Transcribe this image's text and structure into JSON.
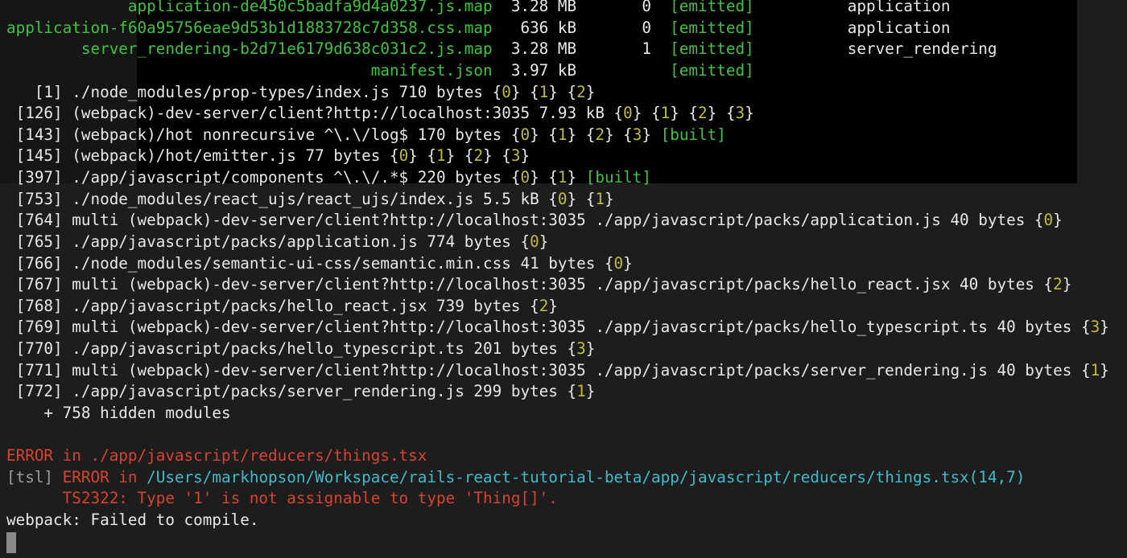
{
  "colors": {
    "white": "#e8e8e8",
    "green": "#3fc43f",
    "yellow": "#c2bc3a",
    "red": "#d8432f",
    "cyan": "#3fbccc",
    "gray": "#9c9c9c"
  },
  "terminal": {
    "lines": [
      {
        "segs": [
          [
            "g",
            "             application-de450c5badfa9d4a0237.js.map"
          ],
          [
            "w",
            "  3.28 MB       0  "
          ],
          [
            "g",
            "[emitted]"
          ],
          [
            "w",
            "          application"
          ]
        ]
      },
      {
        "segs": [
          [
            "g",
            "application-f60a95756eae9d53b1d1883728c7d358.css.map"
          ],
          [
            "w",
            "   636 kB       0  "
          ],
          [
            "g",
            "[emitted]"
          ],
          [
            "w",
            "          application"
          ]
        ]
      },
      {
        "segs": [
          [
            "g",
            "        server_rendering-b2d71e6179d638c031c2.js.map"
          ],
          [
            "w",
            "  3.28 MB       1  "
          ],
          [
            "g",
            "[emitted]"
          ],
          [
            "w",
            "          server_rendering"
          ]
        ]
      },
      {
        "segs": [
          [
            "g",
            "                                       manifest.json"
          ],
          [
            "w",
            "  3.97 kB          "
          ],
          [
            "g",
            "[emitted]"
          ]
        ]
      },
      {
        "segs": [
          [
            "w",
            "   [1] ./node_modules/prop-types/index.js 710 bytes {"
          ],
          [
            "y",
            "0"
          ],
          [
            "w",
            "} {"
          ],
          [
            "y",
            "1"
          ],
          [
            "w",
            "} {"
          ],
          [
            "y",
            "2"
          ],
          [
            "w",
            "}"
          ]
        ]
      },
      {
        "segs": [
          [
            "w",
            " [126] (webpack)-dev-server/client?http://localhost:3035 7.93 kB {"
          ],
          [
            "y",
            "0"
          ],
          [
            "w",
            "} {"
          ],
          [
            "y",
            "1"
          ],
          [
            "w",
            "} {"
          ],
          [
            "y",
            "2"
          ],
          [
            "w",
            "} {"
          ],
          [
            "y",
            "3"
          ],
          [
            "w",
            "}"
          ]
        ]
      },
      {
        "segs": [
          [
            "w",
            " [143] (webpack)/hot nonrecursive ^\\.\\/log$ 170 bytes {"
          ],
          [
            "y",
            "0"
          ],
          [
            "w",
            "} {"
          ],
          [
            "y",
            "1"
          ],
          [
            "w",
            "} {"
          ],
          [
            "y",
            "2"
          ],
          [
            "w",
            "} {"
          ],
          [
            "y",
            "3"
          ],
          [
            "w",
            "} "
          ],
          [
            "g",
            "[built]"
          ]
        ]
      },
      {
        "segs": [
          [
            "w",
            " [145] (webpack)/hot/emitter.js 77 bytes {"
          ],
          [
            "y",
            "0"
          ],
          [
            "w",
            "} {"
          ],
          [
            "y",
            "1"
          ],
          [
            "w",
            "} {"
          ],
          [
            "y",
            "2"
          ],
          [
            "w",
            "} {"
          ],
          [
            "y",
            "3"
          ],
          [
            "w",
            "}"
          ]
        ]
      },
      {
        "segs": [
          [
            "w",
            " [397] ./app/javascript/components ^\\.\\/.*$ 220 bytes {"
          ],
          [
            "y",
            "0"
          ],
          [
            "w",
            "} {"
          ],
          [
            "y",
            "1"
          ],
          [
            "w",
            "} "
          ],
          [
            "g",
            "[built]"
          ]
        ]
      },
      {
        "segs": [
          [
            "w",
            " [753] ./node_modules/react_ujs/react_ujs/index.js 5.5 kB {"
          ],
          [
            "y",
            "0"
          ],
          [
            "w",
            "} {"
          ],
          [
            "y",
            "1"
          ],
          [
            "w",
            "}"
          ]
        ]
      },
      {
        "segs": [
          [
            "w",
            " [764] multi (webpack)-dev-server/client?http://localhost:3035 ./app/javascript/packs/application.js 40 bytes {"
          ],
          [
            "y",
            "0"
          ],
          [
            "w",
            "}"
          ]
        ]
      },
      {
        "segs": [
          [
            "w",
            " [765] ./app/javascript/packs/application.js 774 bytes {"
          ],
          [
            "y",
            "0"
          ],
          [
            "w",
            "}"
          ]
        ]
      },
      {
        "segs": [
          [
            "w",
            " [766] ./node_modules/semantic-ui-css/semantic.min.css 41 bytes {"
          ],
          [
            "y",
            "0"
          ],
          [
            "w",
            "}"
          ]
        ]
      },
      {
        "segs": [
          [
            "w",
            " [767] multi (webpack)-dev-server/client?http://localhost:3035 ./app/javascript/packs/hello_react.jsx 40 bytes {"
          ],
          [
            "y",
            "2"
          ],
          [
            "w",
            "}"
          ]
        ]
      },
      {
        "segs": [
          [
            "w",
            " [768] ./app/javascript/packs/hello_react.jsx 739 bytes {"
          ],
          [
            "y",
            "2"
          ],
          [
            "w",
            "}"
          ]
        ]
      },
      {
        "segs": [
          [
            "w",
            " [769] multi (webpack)-dev-server/client?http://localhost:3035 ./app/javascript/packs/hello_typescript.ts 40 bytes {"
          ],
          [
            "y",
            "3"
          ],
          [
            "w",
            "}"
          ]
        ]
      },
      {
        "segs": [
          [
            "w",
            " [770] ./app/javascript/packs/hello_typescript.ts 201 bytes {"
          ],
          [
            "y",
            "3"
          ],
          [
            "w",
            "}"
          ]
        ]
      },
      {
        "segs": [
          [
            "w",
            " [771] multi (webpack)-dev-server/client?http://localhost:3035 ./app/javascript/packs/server_rendering.js 40 bytes {"
          ],
          [
            "y",
            "1"
          ],
          [
            "w",
            "}"
          ]
        ]
      },
      {
        "segs": [
          [
            "w",
            " [772] ./app/javascript/packs/server_rendering.js 299 bytes {"
          ],
          [
            "y",
            "1"
          ],
          [
            "w",
            "}"
          ]
        ]
      },
      {
        "segs": [
          [
            "w",
            "    + 758 hidden modules"
          ]
        ]
      },
      {
        "segs": []
      },
      {
        "segs": [
          [
            "r",
            "ERROR in ./app/javascript/reducers/things.tsx"
          ]
        ]
      },
      {
        "segs": [
          [
            "s",
            "[tsl]"
          ],
          [
            "r",
            " ERROR in "
          ],
          [
            "c",
            "/Users/markhopson/Workspace/rails-react-tutorial-beta/app/javascript/reducers/things.tsx(14,7)"
          ]
        ]
      },
      {
        "segs": [
          [
            "r",
            "      TS2322: Type '1' is not assignable to type 'Thing[]'."
          ]
        ]
      },
      {
        "segs": [
          [
            "w",
            "webpack: Failed to compile."
          ]
        ]
      }
    ]
  }
}
